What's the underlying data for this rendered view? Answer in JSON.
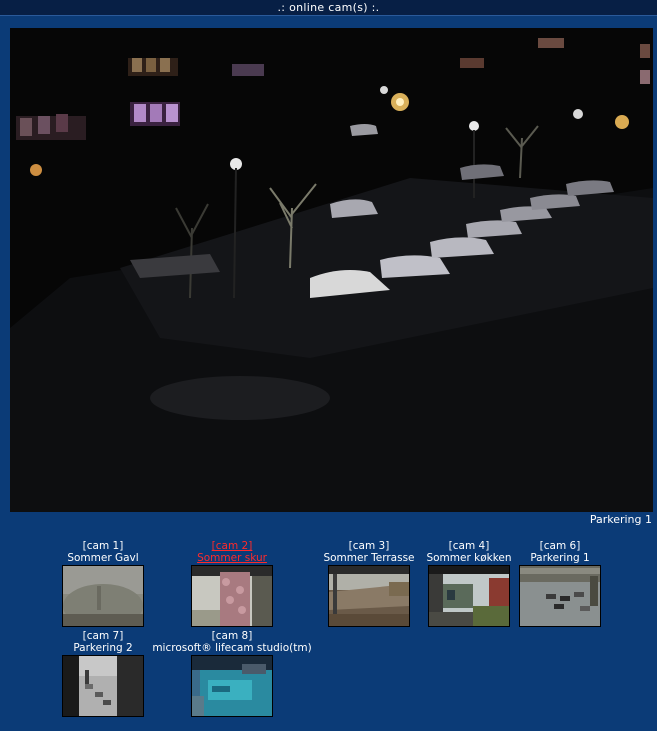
{
  "window": {
    "title": ".: online cam(s) :."
  },
  "main_view": {
    "caption": "Parkering 1",
    "image": "night-parking-lot-webcam"
  },
  "cameras": [
    {
      "id": "[cam 1]",
      "name": "Sommer Gavl",
      "image": "foggy-garden-thumbnail"
    },
    {
      "id": "[cam 2]",
      "name": "Sommer skur",
      "image": "shed-tree-thumbnail",
      "active": true
    },
    {
      "id": "[cam 3]",
      "name": "Sommer Terrasse",
      "image": "terrace-thumbnail"
    },
    {
      "id": "[cam 4]",
      "name": "Sommer køkken",
      "image": "kitchen-yard-thumbnail"
    },
    {
      "id": "[cam 6]",
      "name": "Parkering 1",
      "image": "parking-lot-thumbnail"
    },
    {
      "id": "[cam 7]",
      "name": "Parkering 2",
      "image": "street-parking-thumbnail"
    },
    {
      "id": "[cam 8]",
      "name": "microsoft® lifecam studio(tm)",
      "image": "pool-thumbnail"
    }
  ],
  "colors": {
    "background": "#0b3b77",
    "titlebar": "#071f45",
    "active_link": "#ff2a2a"
  }
}
